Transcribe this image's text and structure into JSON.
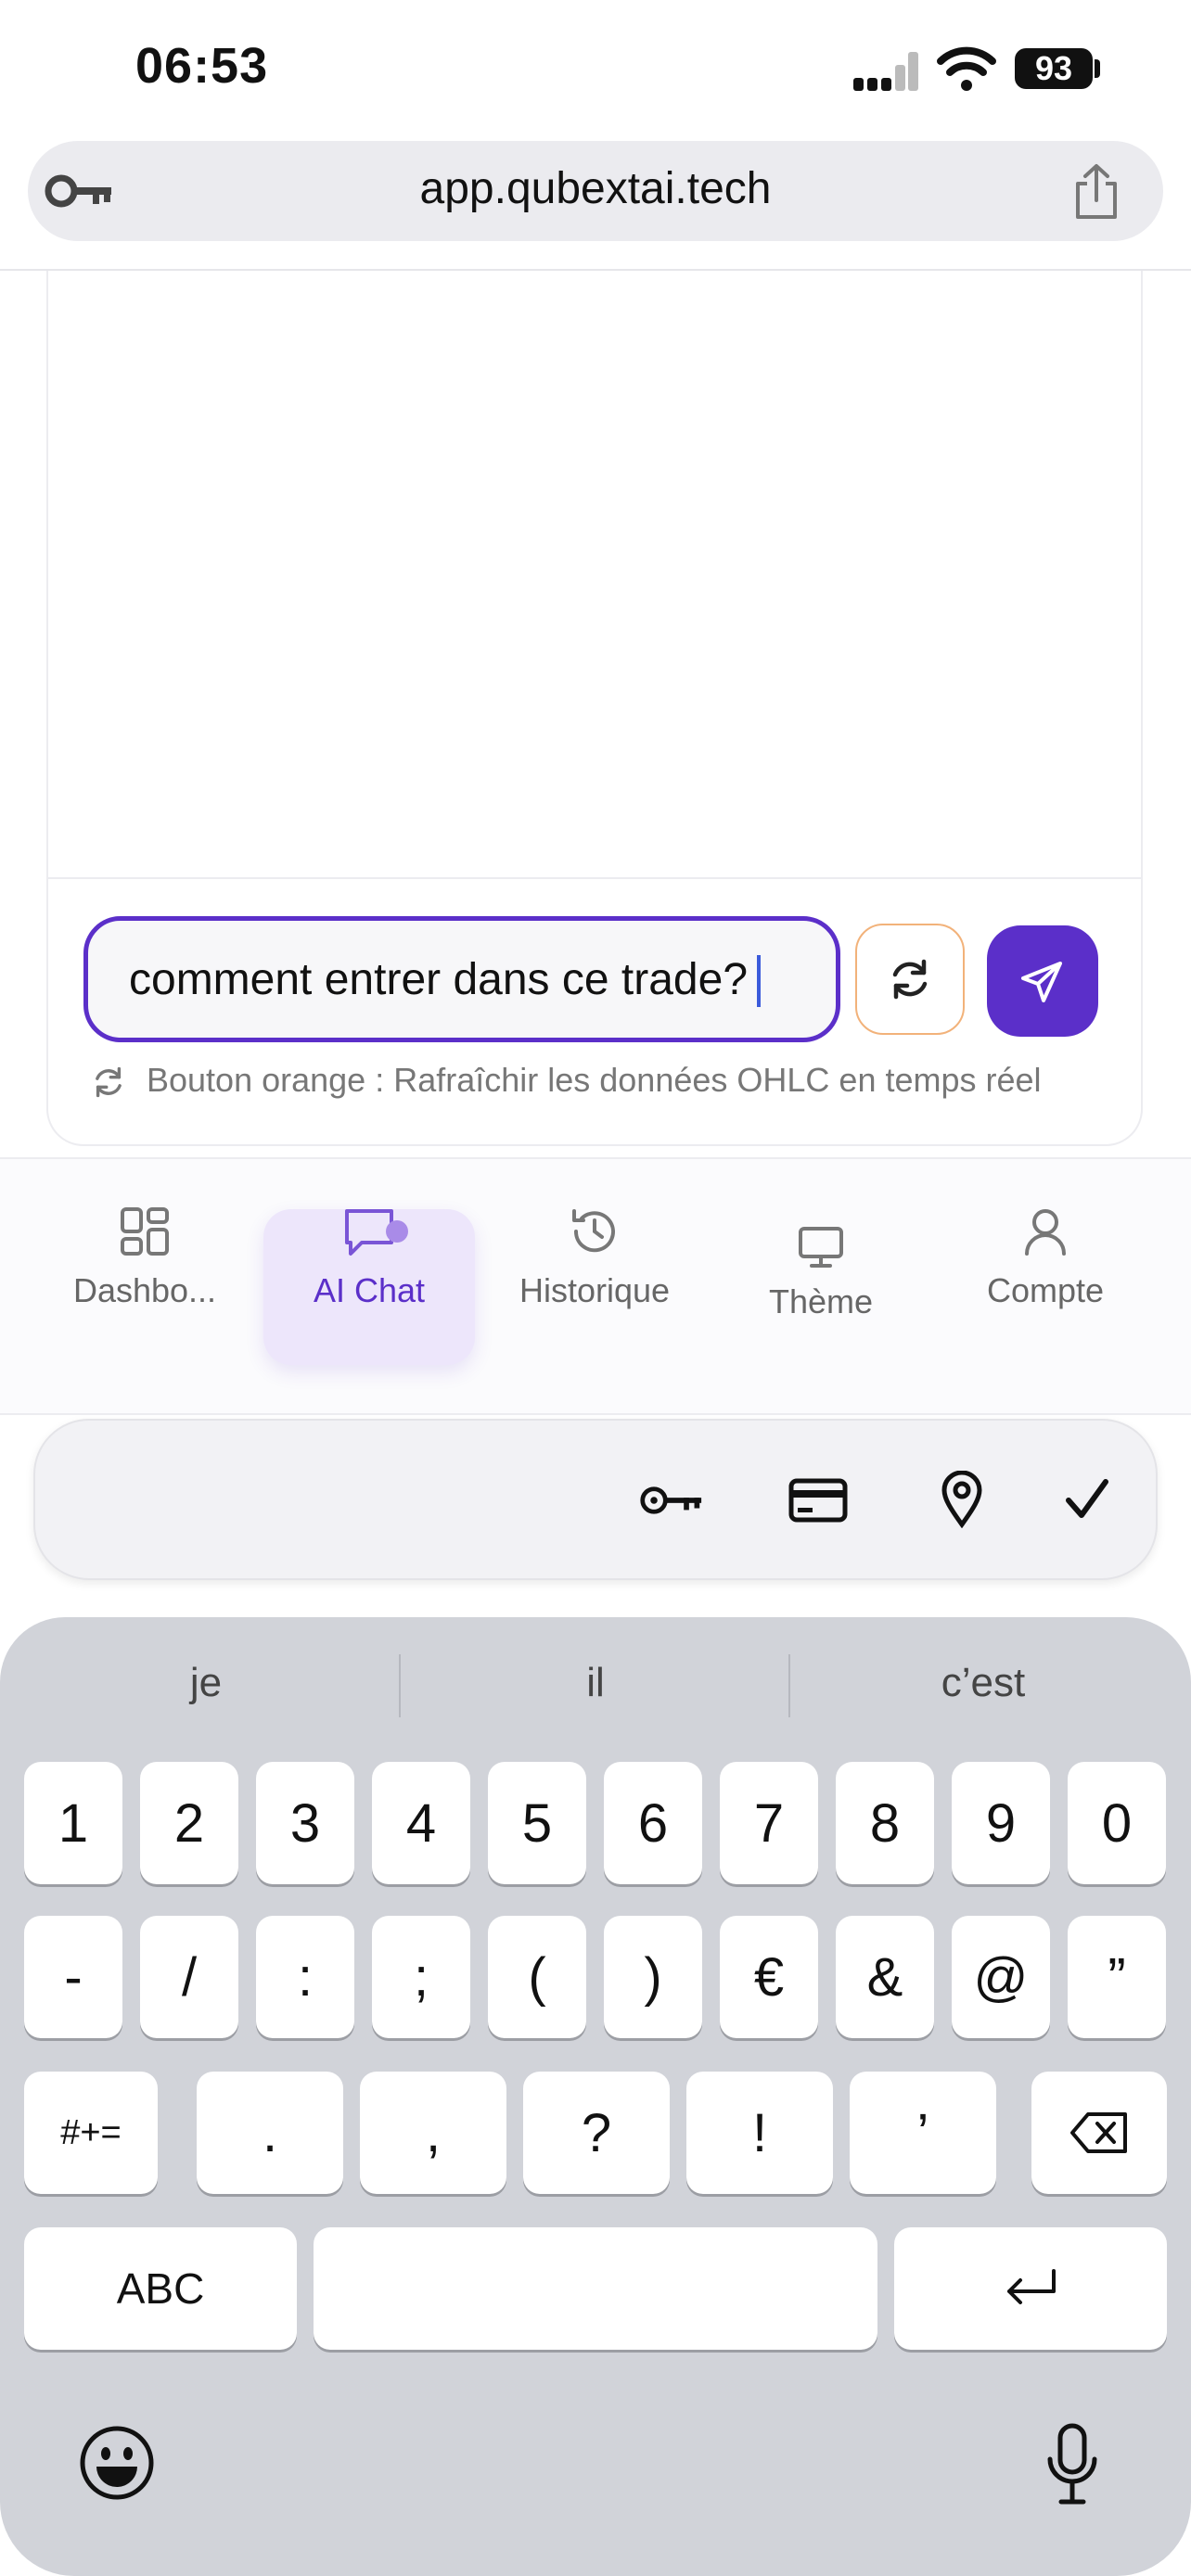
{
  "status_bar": {
    "time": "06:53",
    "battery": "93"
  },
  "browser": {
    "url": "app.qubextai.tech"
  },
  "chat": {
    "input_value": "comment entrer dans ce trade?",
    "hint": "Bouton orange : Rafraîchir les données OHLC en temps réel"
  },
  "nav": {
    "items": [
      {
        "label": "Dashbo...",
        "icon": "dashboard-icon"
      },
      {
        "label": "AI Chat",
        "icon": "chat-icon",
        "active": true
      },
      {
        "label": "Historique",
        "icon": "history-icon"
      },
      {
        "label": "Thème",
        "icon": "monitor-icon"
      },
      {
        "label": "Compte",
        "icon": "user-icon"
      }
    ]
  },
  "autofill": {
    "icons": [
      "key-icon",
      "credit-card-icon",
      "location-pin-icon",
      "checkmark-icon"
    ]
  },
  "keyboard": {
    "suggestions": [
      "je",
      "il",
      "c’est"
    ],
    "row1": [
      "1",
      "2",
      "3",
      "4",
      "5",
      "6",
      "7",
      "8",
      "9",
      "0"
    ],
    "row2": [
      "-",
      "/",
      ":",
      ";",
      "(",
      ")",
      "€",
      "&",
      "@",
      "”"
    ],
    "row3": {
      "shift": "#+=",
      "keys": [
        ".",
        ",",
        "?",
        "!",
        "’"
      ]
    },
    "row4": {
      "abc": "ABC"
    }
  },
  "colors": {
    "accent": "#5b2fc9",
    "refresh_border": "#f2b27a",
    "active_nav_bg": "#ede6fb"
  }
}
